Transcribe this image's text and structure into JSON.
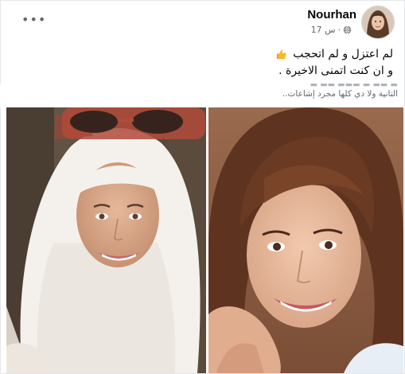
{
  "post": {
    "author_name": "Nourhan",
    "timestamp": "17 س",
    "privacy_icon": "globe-icon",
    "more_icon": "more-options-icon",
    "more_label": "•••",
    "text_line_1": "لم اعتزل و لم اتحجب",
    "text_line_2": "و ان كنت اتمنى الاخيرة .",
    "emoji": "thumbs-up-emoji"
  },
  "shared_image": {
    "caption": "التانية ولا دي كلها مجرد إشاعات..",
    "left_photo": "woman-in-white-hijab-with-sunglasses",
    "right_photo": "woman-with-short-brown-hair-smiling"
  },
  "colors": {
    "text_primary": "#050505",
    "text_secondary": "#65676b",
    "border": "#e4e6eb",
    "emoji_yellow": "#f7b928"
  }
}
